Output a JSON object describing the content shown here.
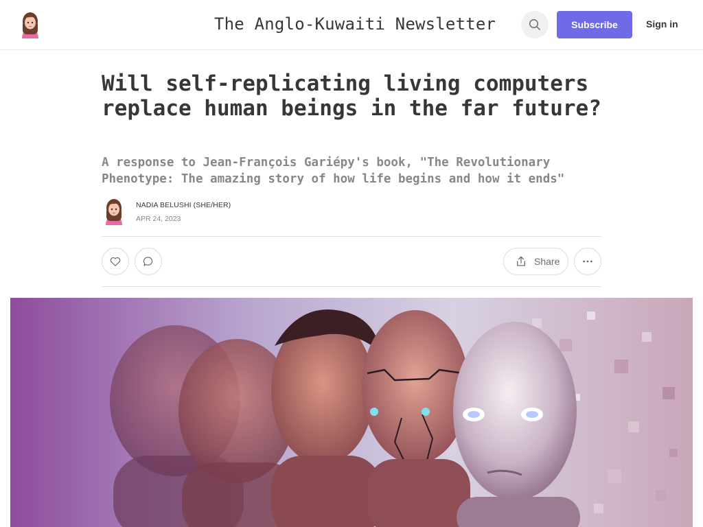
{
  "header": {
    "publication_title": "The Anglo-Kuwaiti Newsletter",
    "subscribe_label": "Subscribe",
    "signin_label": "Sign in",
    "search_icon": "search-icon",
    "accent_color": "#6f6ae8"
  },
  "post": {
    "title": "Will self-replicating living computers replace human beings in the far future?",
    "subtitle": "A response to Jean-François Gariépy's book, \"The Revolutionary Phenotype: The amazing story of how life begins and how it ends\"",
    "author": "NADIA BELUSHI (SHE/HER)",
    "date": "APR 24, 2023"
  },
  "actions": {
    "like_icon": "heart-icon",
    "comment_icon": "comment-icon",
    "share_label": "Share",
    "share_icon": "share-icon",
    "more_icon": "ellipsis-icon"
  },
  "hero": {
    "subject": "human evolution to cyborg faces"
  }
}
